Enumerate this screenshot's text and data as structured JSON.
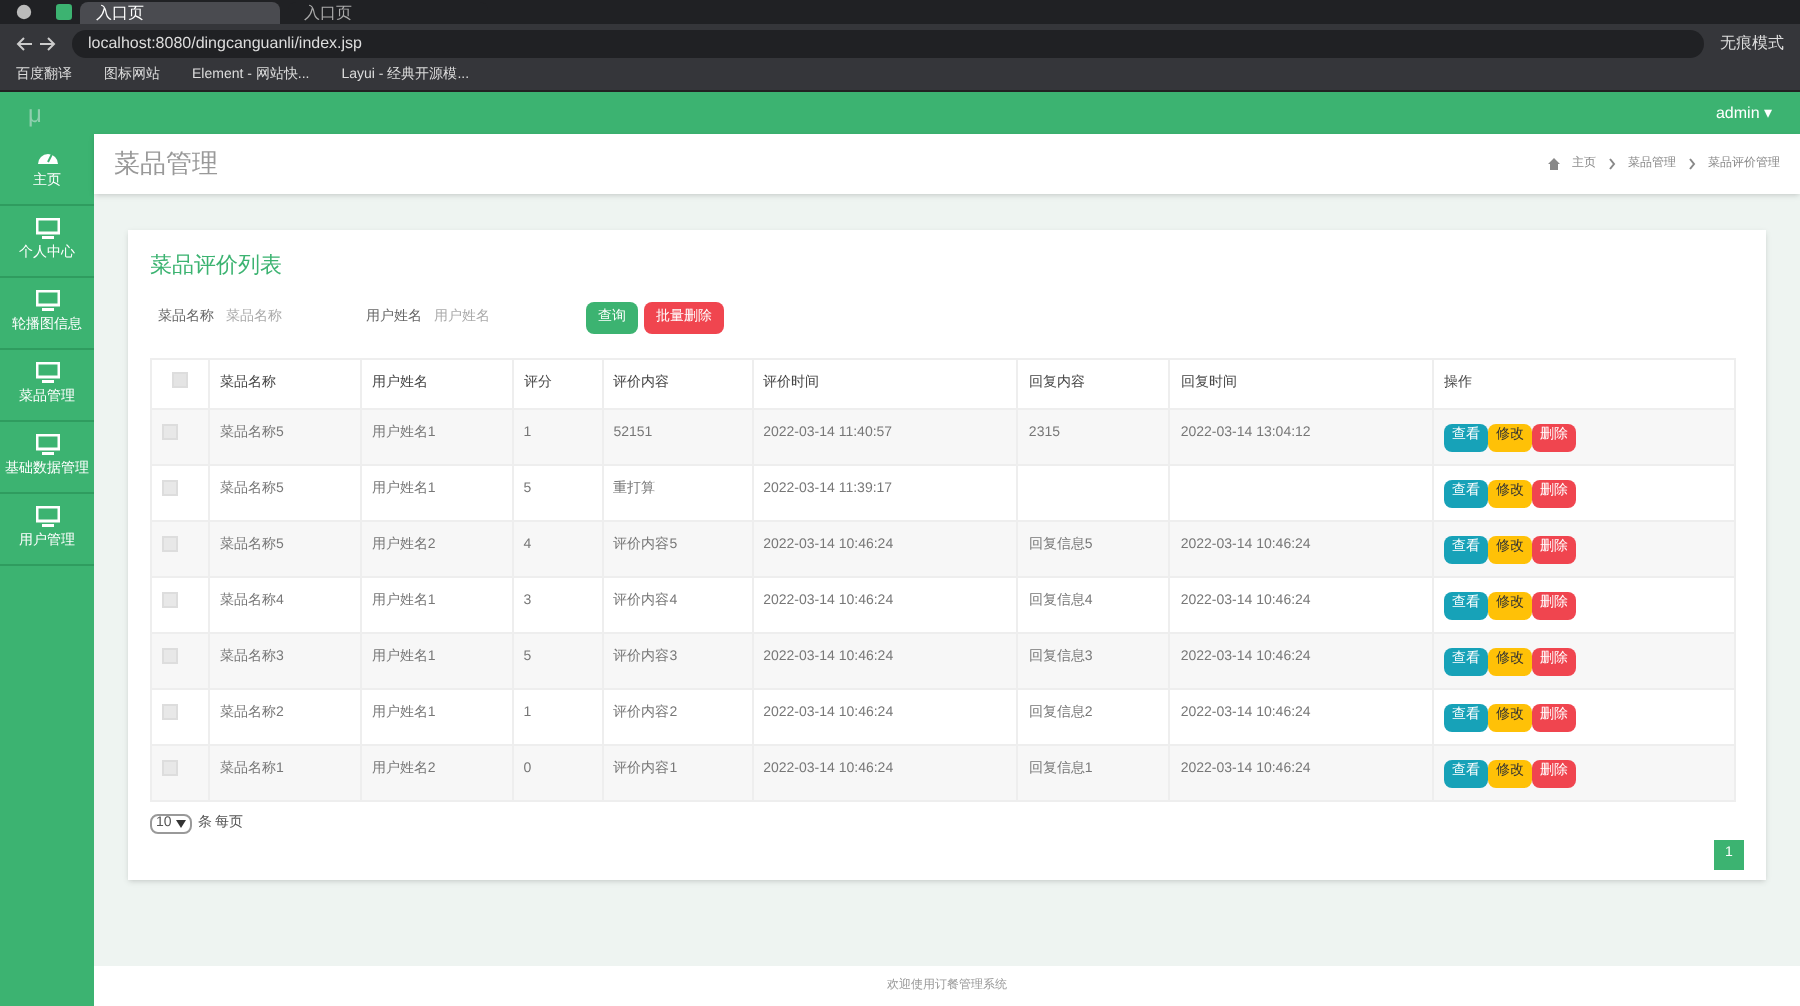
{
  "browser": {
    "tabs": [
      {
        "title": "入口页",
        "selected": true
      },
      {
        "title": "入口页",
        "selected": false
      }
    ],
    "url": "localhost:8080/dingcanguanli/index.jsp",
    "profile": "无痕模式",
    "bookmarks": [
      "百度翻译",
      "图标网站",
      "Element - 网站快...",
      "Layui - 经典开源模..."
    ]
  },
  "header": {
    "logo": "μ",
    "user": "admin ▾"
  },
  "sidebar": {
    "items": [
      {
        "label": "主页",
        "kind": "dashboard"
      },
      {
        "label": "个人中心",
        "kind": "monitor"
      },
      {
        "label": "轮播图信息",
        "kind": "monitor"
      },
      {
        "label": "菜品管理",
        "kind": "monitor"
      },
      {
        "label": "基础数据管理",
        "kind": "monitor"
      },
      {
        "label": "用户管理",
        "kind": "monitor"
      }
    ]
  },
  "page": {
    "title": "菜品管理",
    "breadcrumb": [
      "主页",
      "菜品管理",
      "菜品评价管理"
    ]
  },
  "card": {
    "title": "菜品评价列表",
    "filters": [
      {
        "label": "菜品名称",
        "placeholder": "菜品名称"
      },
      {
        "label": "用户姓名",
        "placeholder": "用户姓名"
      }
    ],
    "buttons": [
      {
        "label": "查询",
        "kind": "search"
      },
      {
        "label": "批量删除",
        "kind": "danger"
      }
    ],
    "table": {
      "all_checked": false,
      "columns": [
        "菜品名称",
        "用户姓名",
        "评分",
        "评价内容",
        "评价时间",
        "回复内容",
        "回复时间",
        "操作"
      ],
      "rows": [
        {
          "checked": false,
          "cells": [
            "菜品名称5",
            "用户姓名1",
            "1",
            "52151",
            "2022-03-14 11:40:57",
            "2315",
            "2022-03-14 13:04:12"
          ],
          "actions": [
            "查看",
            "修改",
            "删除"
          ]
        },
        {
          "checked": false,
          "cells": [
            "菜品名称5",
            "用户姓名1",
            "5",
            "重打算",
            "2022-03-14 11:39:17",
            "",
            ""
          ],
          "actions": [
            "查看",
            "修改",
            "删除"
          ]
        },
        {
          "checked": false,
          "cells": [
            "菜品名称5",
            "用户姓名2",
            "4",
            "评价内容5",
            "2022-03-14 10:46:24",
            "回复信息5",
            "2022-03-14 10:46:24"
          ],
          "actions": [
            "查看",
            "修改",
            "删除"
          ]
        },
        {
          "checked": false,
          "cells": [
            "菜品名称4",
            "用户姓名1",
            "3",
            "评价内容4",
            "2022-03-14 10:46:24",
            "回复信息4",
            "2022-03-14 10:46:24"
          ],
          "actions": [
            "查看",
            "修改",
            "删除"
          ]
        },
        {
          "checked": false,
          "cells": [
            "菜品名称3",
            "用户姓名1",
            "5",
            "评价内容3",
            "2022-03-14 10:46:24",
            "回复信息3",
            "2022-03-14 10:46:24"
          ],
          "actions": [
            "查看",
            "修改",
            "删除"
          ]
        },
        {
          "checked": false,
          "cells": [
            "菜品名称2",
            "用户姓名1",
            "1",
            "评价内容2",
            "2022-03-14 10:46:24",
            "回复信息2",
            "2022-03-14 10:46:24"
          ],
          "actions": [
            "查看",
            "修改",
            "删除"
          ]
        },
        {
          "checked": false,
          "cells": [
            "菜品名称1",
            "用户姓名2",
            "0",
            "评价内容1",
            "2022-03-14 10:46:24",
            "回复信息1",
            "2022-03-14 10:46:24"
          ],
          "actions": [
            "查看",
            "修改",
            "删除"
          ]
        }
      ]
    },
    "page_size": {
      "value": "10",
      "suffix": "条 每页"
    },
    "pages": [
      {
        "label": "1",
        "selected": true
      }
    ]
  },
  "footer": "欢迎使用订餐管理系统"
}
